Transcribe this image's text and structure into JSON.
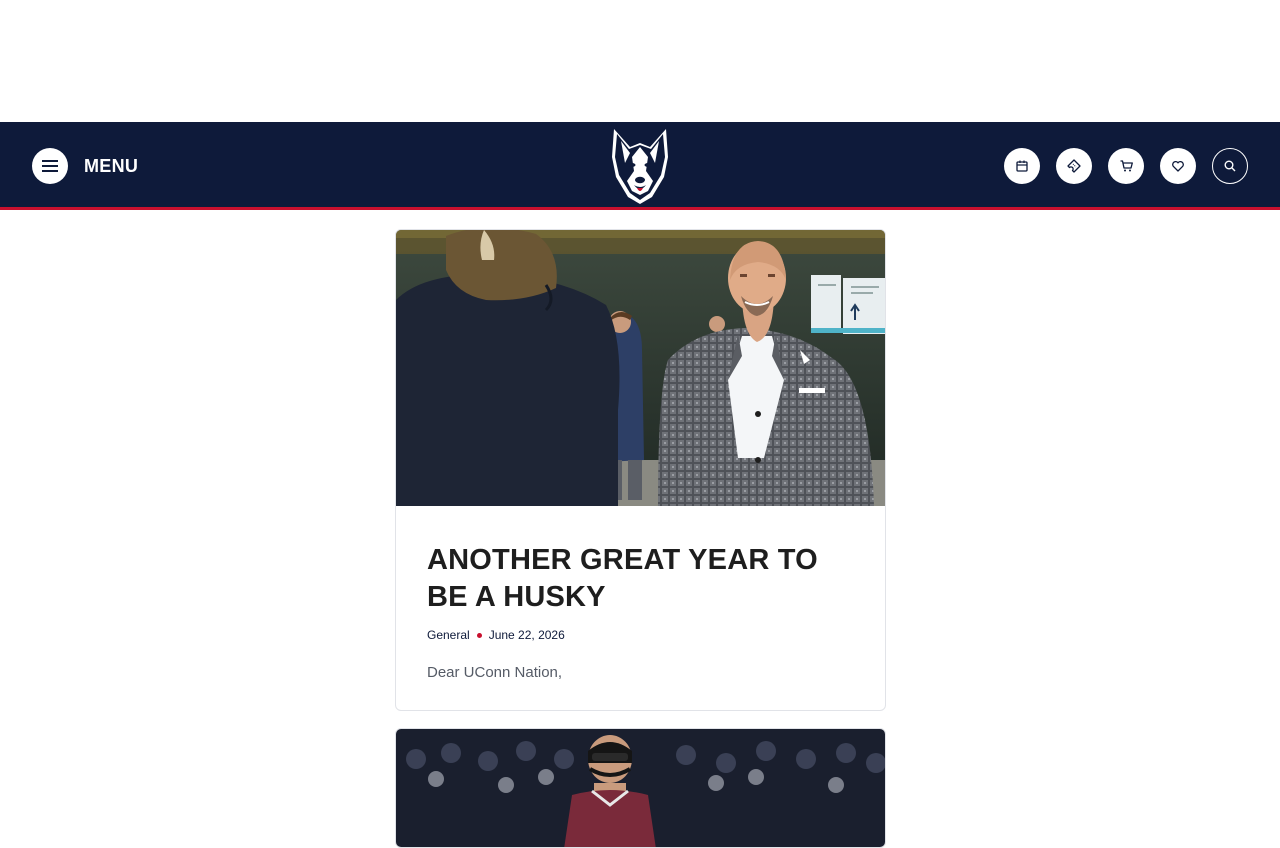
{
  "header": {
    "menu_label": "MENU",
    "icons": [
      "menu-icon",
      "husky-logo",
      "calendar-icon",
      "ticket-icon",
      "cart-icon",
      "heart-icon",
      "search-icon"
    ],
    "colors": {
      "navy": "#0e1a3a",
      "accent_red": "#c8102e"
    }
  },
  "articles": [
    {
      "title": "ANOTHER GREAT YEAR TO BE A HUSKY",
      "category": "General",
      "date": "June 22, 2026",
      "excerpt": "Dear UConn Nation,",
      "image": "photo-man-in-plaid-blazer-smiling"
    },
    {
      "image": "photo-basketball-player-in-mask"
    }
  ]
}
